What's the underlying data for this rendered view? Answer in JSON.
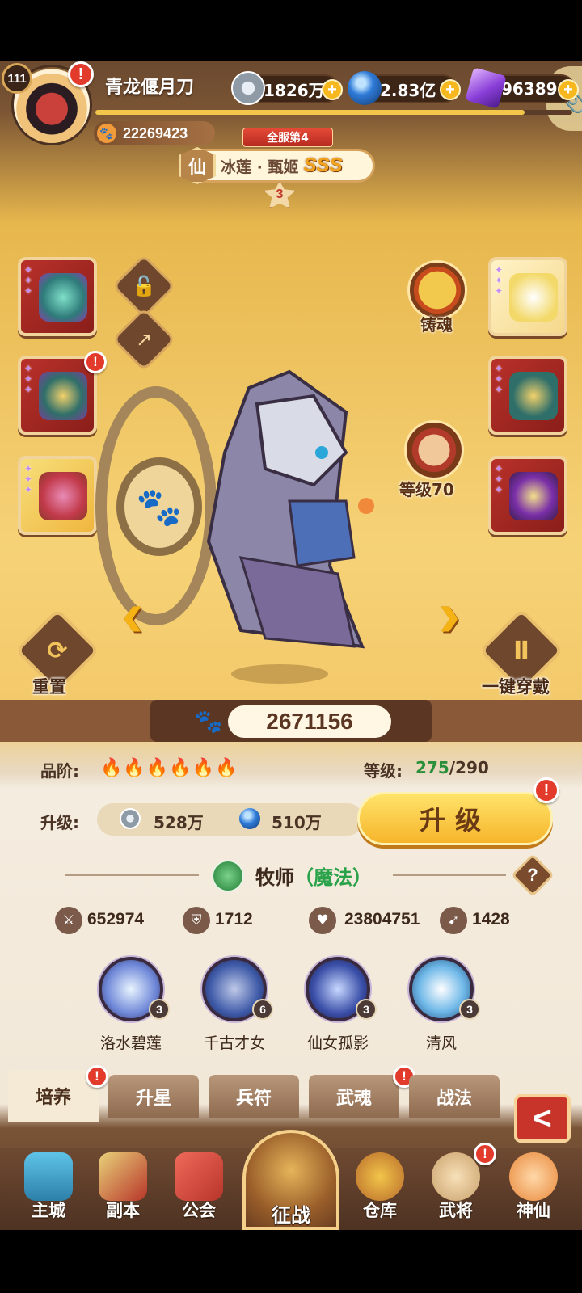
{
  "player": {
    "level": "111",
    "name": "青龙偃月刀",
    "power": "22269423"
  },
  "currencies": [
    {
      "name": "coin",
      "value": "1826万",
      "color": "#9aa6b4"
    },
    {
      "name": "orb",
      "value": "2.83亿",
      "color": "#2f7bd8"
    },
    {
      "name": "crystal",
      "value": "96389",
      "color": "#8a3fd8"
    }
  ],
  "exp_progress": 0.9,
  "hero": {
    "server_rank": "全服第4",
    "tier_badge": "仙",
    "name": "冰莲 · 甄姬",
    "grade": "SSS",
    "stars": "3",
    "combat_power": "2671156",
    "quality_label": "品阶:",
    "quality_drops": "🔥🔥🔥🔥🔥🔥",
    "level_label": "等级:",
    "level_current": "275",
    "level_max": "/290",
    "upgrade_label": "升级:",
    "upgrade_cost_coin": "528万",
    "upgrade_cost_orb": "510万",
    "upgrade_button": "升级",
    "class_name": "牧师",
    "class_type": "（魔法）",
    "stats": {
      "attack": "652974",
      "defense": "1712",
      "hp": "23804751",
      "speed": "1428"
    }
  },
  "side_buttons": {
    "forge_soul": "铸魂",
    "weapon_level": "等级70",
    "reset": "重置",
    "equip_all": "一键穿戴"
  },
  "skills": [
    {
      "name": "洛水碧莲",
      "level": "3"
    },
    {
      "name": "千古才女",
      "level": "6"
    },
    {
      "name": "仙女孤影",
      "level": "3"
    },
    {
      "name": "清风",
      "level": "3"
    }
  ],
  "tabs": [
    {
      "label": "培养"
    },
    {
      "label": "升星"
    },
    {
      "label": "兵符"
    },
    {
      "label": "武魂"
    },
    {
      "label": "战法"
    }
  ],
  "nav": [
    {
      "label": "主城"
    },
    {
      "label": "副本"
    },
    {
      "label": "公会"
    },
    {
      "label": "征战"
    },
    {
      "label": "仓库"
    },
    {
      "label": "武将"
    },
    {
      "label": "神仙"
    }
  ],
  "icons": {
    "alert": "!",
    "plus": "+",
    "paw": "🐾",
    "back": "<"
  }
}
